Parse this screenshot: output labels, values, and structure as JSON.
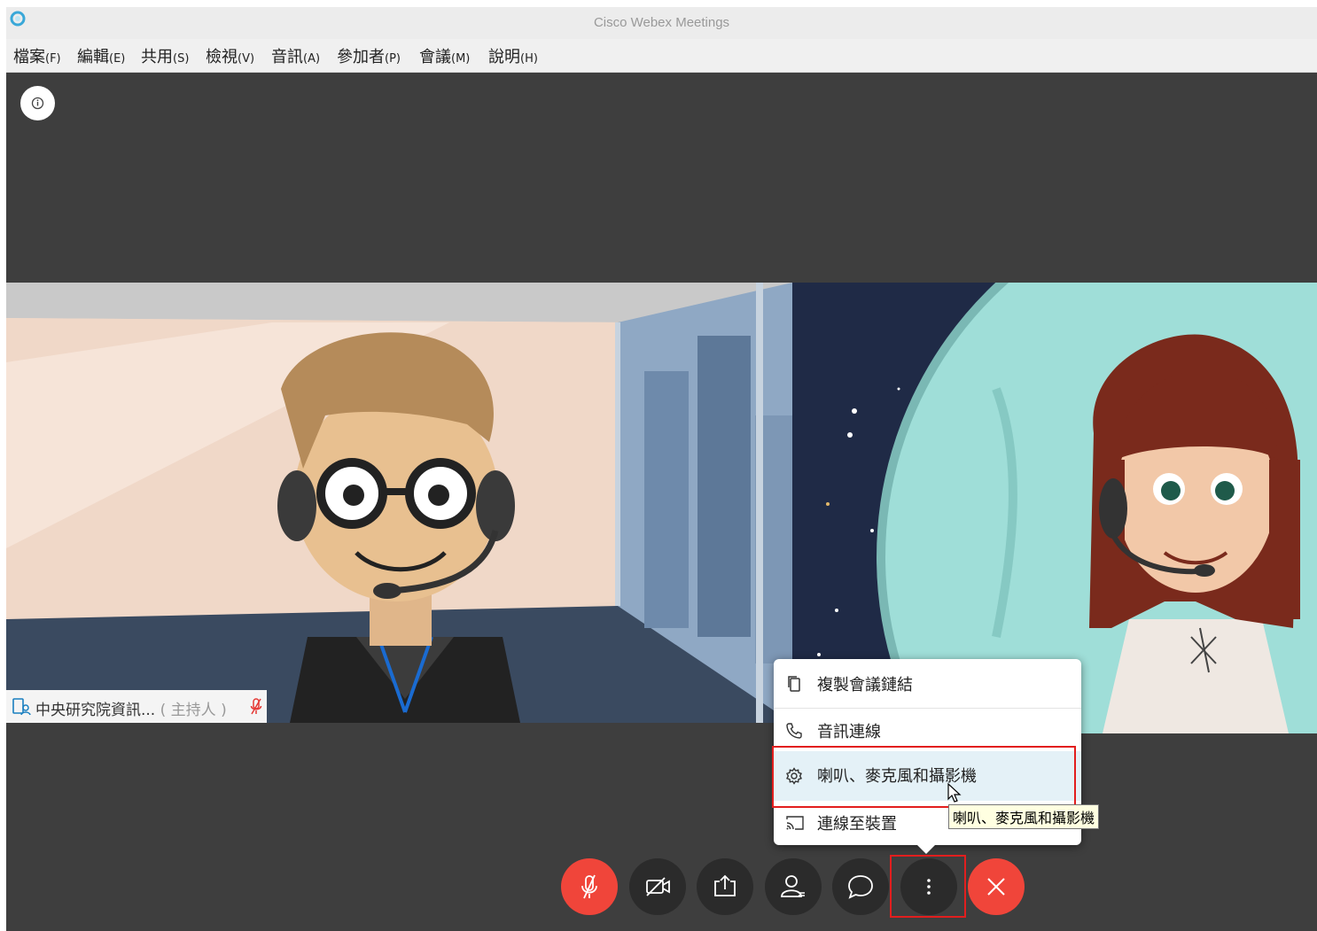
{
  "window": {
    "title": "Cisco Webex Meetings"
  },
  "menubar": {
    "items": [
      {
        "label": "檔案",
        "accel": "(F)"
      },
      {
        "label": "編輯",
        "accel": "(E)"
      },
      {
        "label": "共用",
        "accel": "(S)"
      },
      {
        "label": "檢視",
        "accel": "(V)"
      },
      {
        "label": "音訊",
        "accel": "(A)"
      },
      {
        "label": "參加者",
        "accel": "(P)"
      },
      {
        "label": "會議",
        "accel": "(M)"
      },
      {
        "label": "說明",
        "accel": "(H)"
      }
    ]
  },
  "video": {
    "participant_name": "中央研究院資訊...",
    "host_tag": "( 主持人 )"
  },
  "more_menu": {
    "items": [
      {
        "label": "複製會議鏈結",
        "icon": "copy-icon"
      },
      {
        "label": "音訊連線",
        "icon": "phone-icon"
      },
      {
        "label": "喇叭、麥克風和攝影機",
        "icon": "gear-icon"
      },
      {
        "label": "連線至裝置",
        "icon": "cast-icon"
      }
    ],
    "hovered_index": 2
  },
  "tooltip": {
    "text": "喇叭、麥克風和攝影機"
  },
  "controls": {
    "buttons": [
      {
        "icon": "microphone-muted-icon"
      },
      {
        "icon": "video-off-icon"
      },
      {
        "icon": "share-icon"
      },
      {
        "icon": "participants-icon"
      },
      {
        "icon": "chat-icon"
      },
      {
        "icon": "more-icon"
      },
      {
        "icon": "close-icon"
      }
    ]
  },
  "colors": {
    "accent_red": "#f0453a",
    "annotation_red": "#e21e1e",
    "stage_background": "#3e3e3e",
    "hover_highlight": "#e4f1f7"
  }
}
